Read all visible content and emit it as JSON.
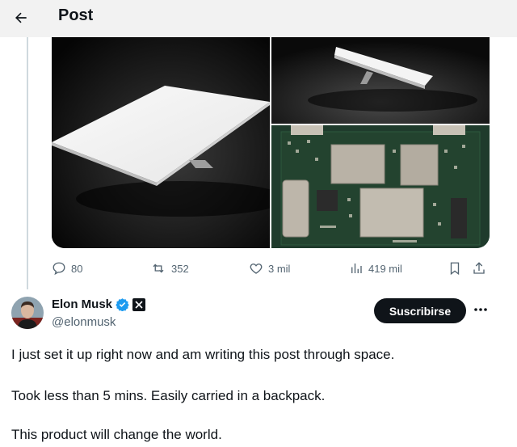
{
  "header": {
    "title": "Post",
    "back_icon": "arrow-left-icon"
  },
  "tweet": {
    "stats": {
      "replies": "80",
      "reposts": "352",
      "likes": "3 mil",
      "views": "419 mil"
    },
    "author": {
      "name": "Elon Musk",
      "handle": "@elonmusk",
      "verified": true,
      "affiliation_badge": "x-logo"
    },
    "subscribe_label": "Suscribirse",
    "more_icon": "ellipsis-icon",
    "lines": [
      "I just set it up right now and am writing this post through space.",
      "Took less than 5 mins. Easily carried in a backpack.",
      "This product will change the world."
    ]
  },
  "colors": {
    "text": "#0f1419",
    "muted": "#536471",
    "verified": "#1d9bf0",
    "header_bg": "#f2f2f2"
  }
}
